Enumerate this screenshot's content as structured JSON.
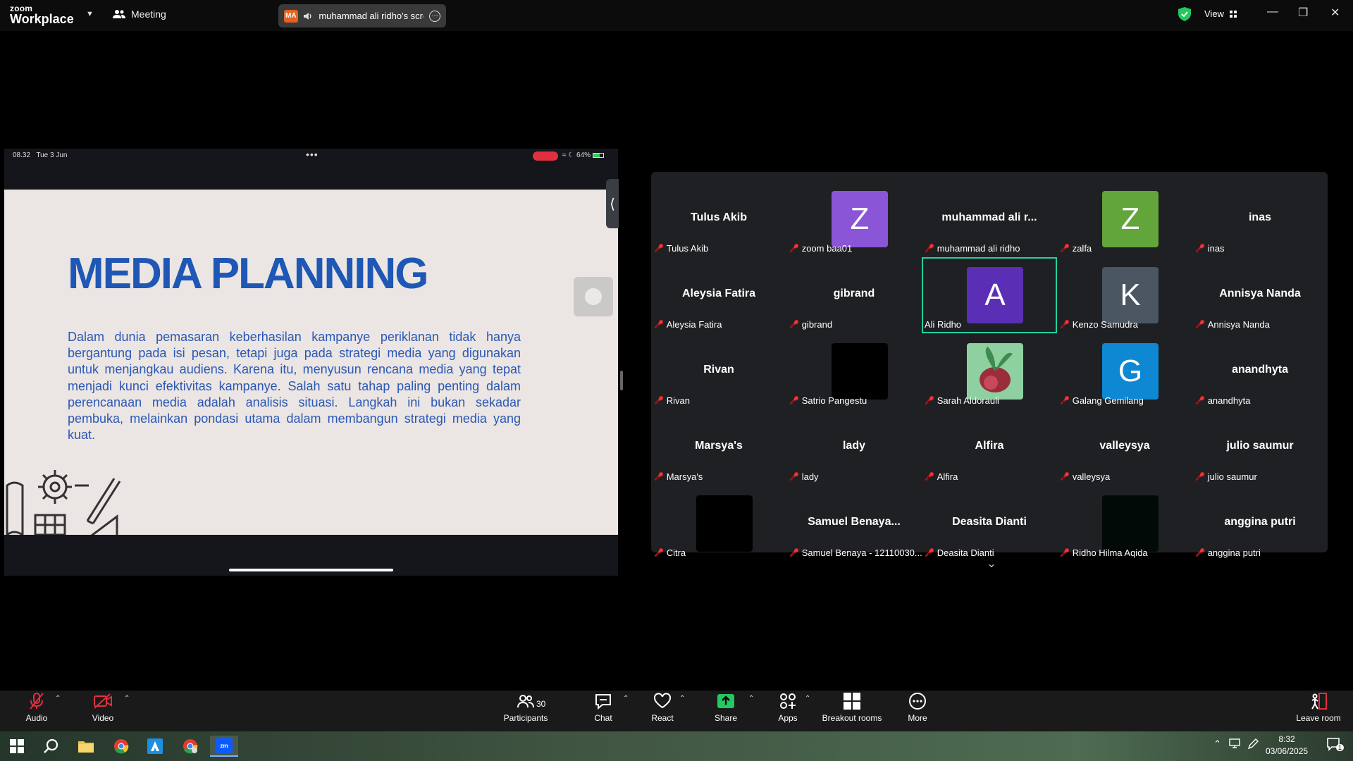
{
  "titlebar": {
    "brand_line1": "zoom",
    "brand_line2": "Workplace",
    "meeting_label": "Meeting",
    "share_initials": "MA",
    "share_label": "muhammad ali ridho's screen",
    "view_label": "View",
    "colors": {
      "share_badge": "#e5611f",
      "shield": "#23c860"
    }
  },
  "shared_screen": {
    "status_time": "08.32",
    "status_date": "Tue 3 Jun",
    "status_battery": "64%",
    "slide_title": "MEDIA PLANNING",
    "slide_body": "Dalam dunia pemasaran keberhasilan kampanye periklanan tidak hanya bergantung pada isi pesan, tetapi juga pada strategi media yang digunakan untuk menjangkau audiens. Karena itu, menyusun rencana media yang tepat menjadi kunci efektivitas kampanye. Salah satu tahap paling penting dalam perencanaan media adalah analisis situasi. Langkah ini bukan sekadar pembuka, melainkan pondasi utama dalam membangun strategi media yang kuat.",
    "colors": {
      "slide_bg": "#ebe5e3",
      "title": "#1e57b5"
    }
  },
  "gallery": {
    "tiles": [
      {
        "center": "Tulus Akib",
        "label": "Tulus Akib"
      },
      {
        "avatar": "Z",
        "avatar_color": "#8a55d6",
        "label": "zoom baa01"
      },
      {
        "center": "muhammad ali r...",
        "label": "muhammad ali ridho"
      },
      {
        "avatar": "Z",
        "avatar_color": "#62a53b",
        "label": "zalfa"
      },
      {
        "center": "inas",
        "label": "inas"
      },
      {
        "center": "Aleysia Fatira",
        "label": "Aleysia Fatira"
      },
      {
        "center": "gibrand",
        "label": "gibrand"
      },
      {
        "avatar": "A",
        "avatar_color": "#5a2fb5",
        "label": "Ali Ridho",
        "active": true,
        "no_mic": true
      },
      {
        "avatar": "K",
        "avatar_color": "#4a5661",
        "label": "Kenzo Samudra"
      },
      {
        "center": "Annisya Nanda",
        "label": "Annisya Nanda"
      },
      {
        "center": "Rivan",
        "label": "Rivan"
      },
      {
        "avatar": "",
        "avatar_color": "#000000",
        "label": "Satrio Pangestu"
      },
      {
        "avatar": "",
        "avatar_color": "#8fd0a0",
        "label": "Sarah Aldorauli",
        "picture": true
      },
      {
        "avatar": "G",
        "avatar_color": "#0f88d4",
        "label": "Galang Gemilang"
      },
      {
        "center": "anandhyta",
        "label": "anandhyta"
      },
      {
        "center": "Marsya's",
        "label": "Marsya's"
      },
      {
        "center": "lady",
        "label": "lady"
      },
      {
        "center": "Alfira",
        "label": "Alfira"
      },
      {
        "center": "valleysya",
        "label": "valleysya"
      },
      {
        "center": "julio saumur",
        "label": "julio saumur"
      },
      {
        "avatar": "",
        "avatar_color": "#000000",
        "label": "Citra"
      },
      {
        "center": "Samuel  Benaya...",
        "label": "Samuel Benaya - 12110030..."
      },
      {
        "center": "Deasita Dianti",
        "label": "Deasita Dianti"
      },
      {
        "avatar": "",
        "avatar_color": "#020a08",
        "label": "Ridho Hilma Aqida"
      },
      {
        "center": "anggina putri",
        "label": "anggina putri"
      }
    ],
    "colors": {
      "active_border": "#23d0a1",
      "muted_mic": "#e0303f"
    }
  },
  "toolbar": {
    "audio": "Audio",
    "video": "Video",
    "participants": "Participants",
    "participants_count": "30",
    "chat": "Chat",
    "react": "React",
    "share": "Share",
    "apps": "Apps",
    "breakout": "Breakout rooms",
    "more": "More",
    "leave": "Leave room",
    "colors": {
      "share": "#23c860",
      "muted": "#e0303f"
    }
  },
  "taskbar": {
    "time": "8:32",
    "date": "03/06/2025",
    "notification_count": "1"
  }
}
